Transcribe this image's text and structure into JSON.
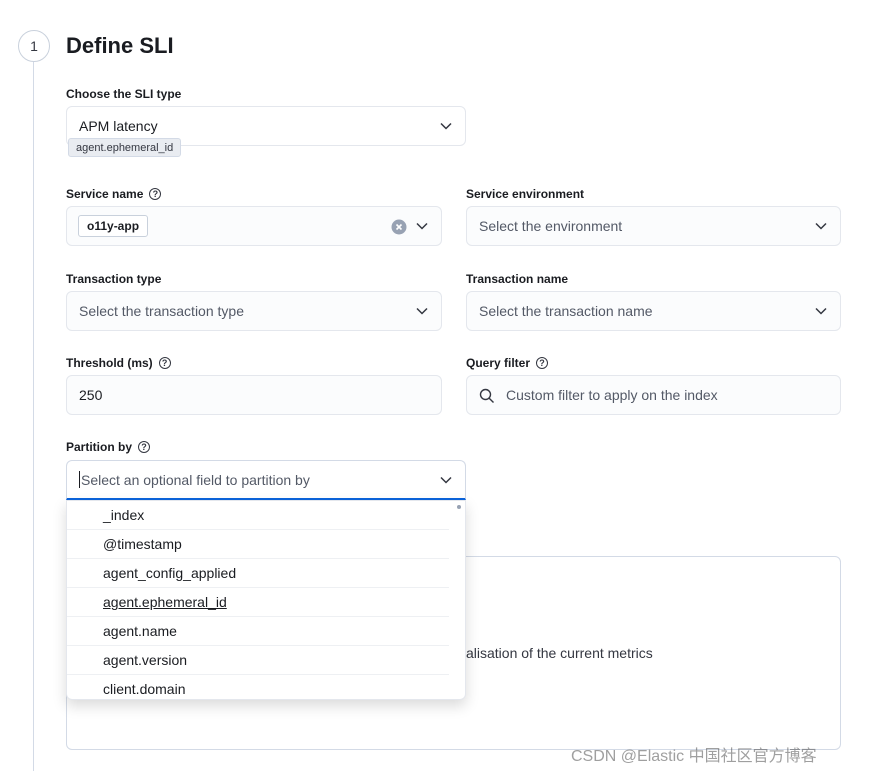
{
  "step": {
    "number": "1",
    "title": "Define SLI"
  },
  "sli_type": {
    "label": "Choose the SLI type",
    "value": "APM latency",
    "tooltip": "agent.ephemeral_id"
  },
  "service_name": {
    "label": "Service name",
    "value": "o11y-app"
  },
  "service_environment": {
    "label": "Service environment",
    "placeholder": "Select the environment"
  },
  "transaction_type": {
    "label": "Transaction type",
    "placeholder": "Select the transaction type"
  },
  "transaction_name": {
    "label": "Transaction name",
    "placeholder": "Select the transaction name"
  },
  "threshold": {
    "label": "Threshold (ms)",
    "value": "250"
  },
  "query_filter": {
    "label": "Query filter",
    "placeholder": "Custom filter to apply on the index"
  },
  "partition_by": {
    "label": "Partition by",
    "placeholder": "Select an optional field to partition by",
    "options": [
      "_index",
      "@timestamp",
      "agent_config_applied",
      "agent.ephemeral_id",
      "agent.name",
      "agent.version",
      "client.domain"
    ]
  },
  "preview_panel": {
    "text": "alisation of the current metrics"
  },
  "watermark": "CSDN @Elastic 中国社区官方博客",
  "icons": {
    "help": "help-icon",
    "chevron": "chevron-down-icon",
    "clear": "clear-icon",
    "search": "search-icon"
  },
  "colors": {
    "focus_border": "#0b64dd",
    "field_bg": "#fbfcfd"
  }
}
